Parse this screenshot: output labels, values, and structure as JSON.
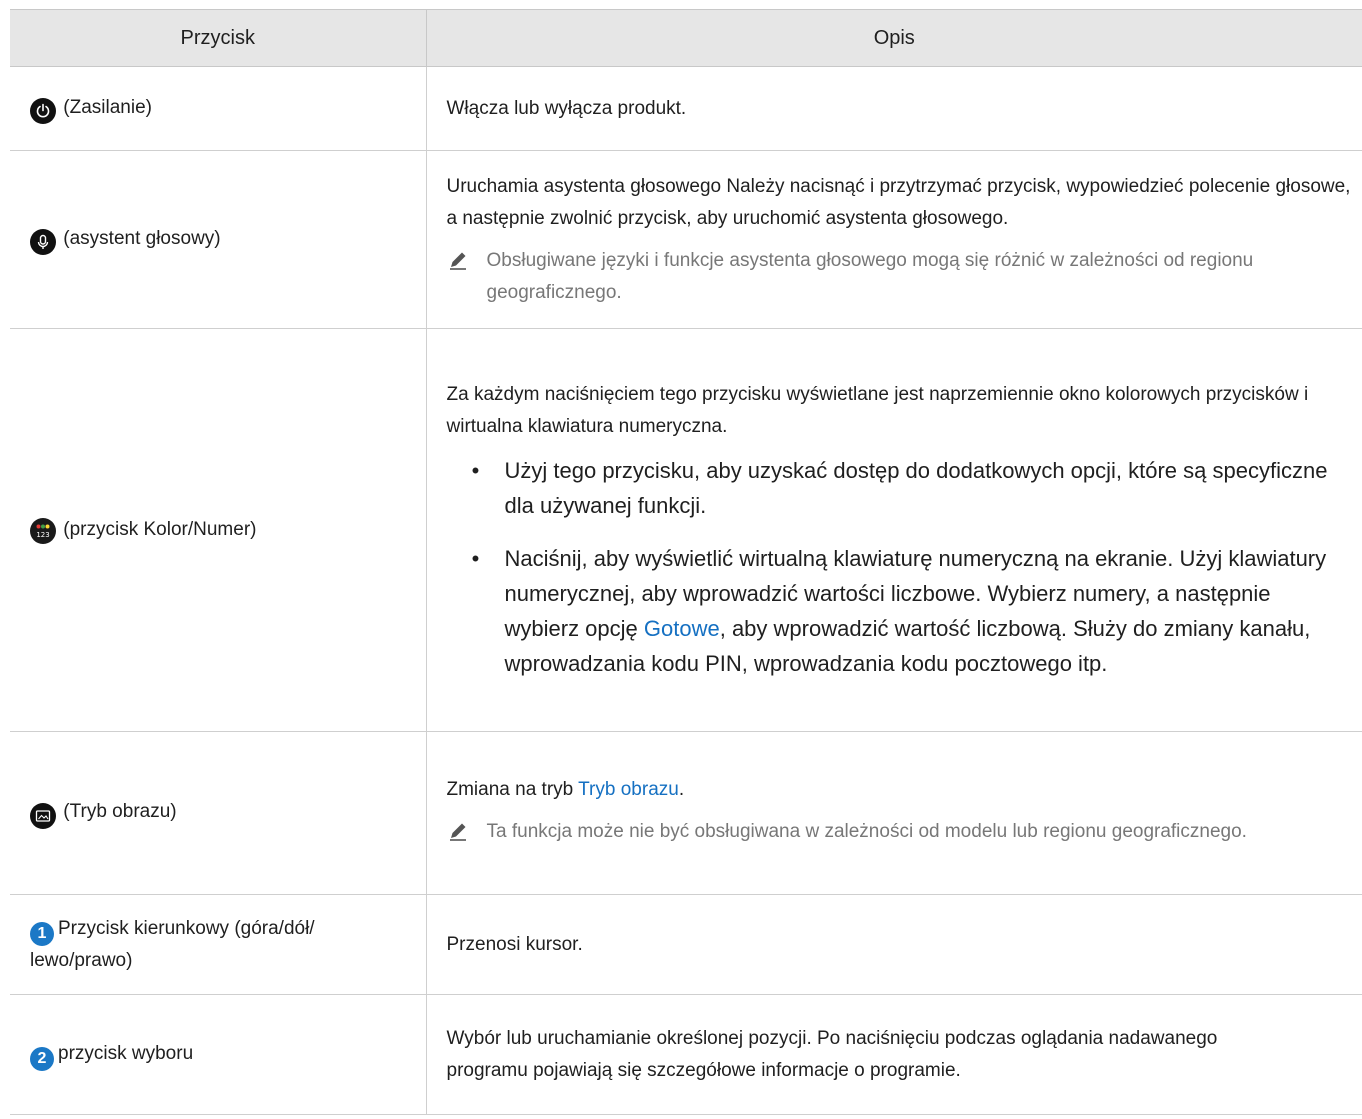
{
  "table": {
    "headers": [
      "Przycisk",
      "Opis"
    ],
    "rows": [
      {
        "icon": "power-icon",
        "button": "(Zasilanie)",
        "desc": "Włącza lub wyłącza produkt."
      },
      {
        "icon": "microphone-icon",
        "button": "(asystent głosowy)",
        "desc": "Uruchamia asystenta głosowego Należy nacisnąć i przytrzymać przycisk, wypowiedzieć polecenie głosowe, a następnie zwolnić przycisk, aby uruchomić asystenta głosowego.",
        "note": "Obsługiwane języki i funkcje asystenta głosowego mogą się różnić w zależności od regionu geograficznego."
      },
      {
        "icon": "color-number-icon",
        "button": "(przycisk Kolor/Numer)",
        "desc": "Za każdym naciśnięciem tego przycisku wyświetlane jest naprzemiennie okno kolorowych przycisków i wirtualna klawiatura numeryczna.",
        "bullets": [
          "Użyj tego przycisku, aby uzyskać dostęp do dodatkowych opcji, które są specyficzne dla używanej funkcji.",
          {
            "pre": "Naciśnij, aby wyświetlić wirtualną klawiaturę numeryczną na ekranie. Użyj klawiatury numerycznej, aby wprowadzić wartości liczbowe. Wybierz numery, a następnie wybierz opcję ",
            "link": "Gotowe",
            "post": ", aby wprowadzić wartość liczbową. Służy do zmiany kanału, wprowadzania kodu PIN, wprowadzania kodu pocztowego itp."
          }
        ]
      },
      {
        "icon": "picture-mode-icon",
        "button": "(Tryb obrazu)",
        "desc_pre": "Zmiana na tryb ",
        "desc_link": "Tryb obrazu",
        "desc_post": ".",
        "note": "Ta funkcja może nie być obsługiwana w zależności od modelu lub regionu geograficznego."
      },
      {
        "number": "1",
        "button": "Przycisk kierunkowy (góra/dół/ lewo/prawo)",
        "desc": "Przenosi kursor."
      },
      {
        "number": "2",
        "button": "przycisk wyboru",
        "desc": "Wybór lub uruchamianie określonej pozycji. Po naciśnięciu podczas oglądania nadawanego programu pojawiają się szczegółowe informacje o programie."
      }
    ]
  },
  "colors": {
    "link": "#1570c2",
    "number_badge": "#1b78c6",
    "header_bg": "#e6e6e6",
    "note_text": "#777777"
  }
}
